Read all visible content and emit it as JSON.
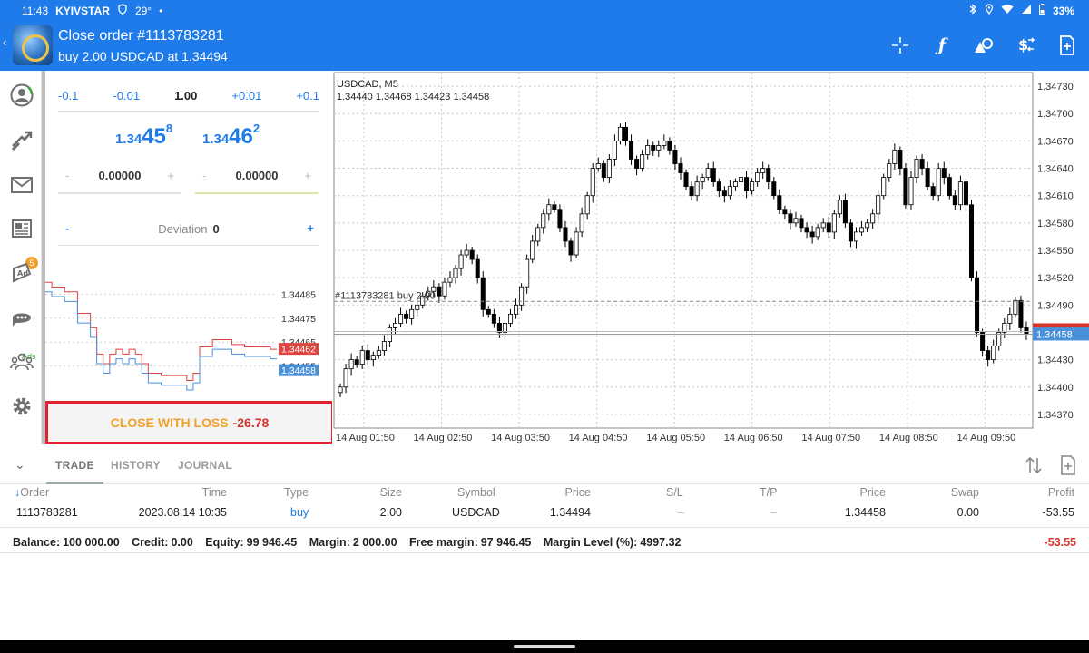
{
  "status": {
    "time": "11:43",
    "carrier": "KYIVSTAR",
    "temp": "29°",
    "dot": "•",
    "battery": "33%"
  },
  "header": {
    "title": "Close order #1113783281",
    "subtitle": "buy 2.00 USDCAD at 1.34494",
    "icons": [
      "crosshair-icon",
      "function-icon",
      "objects-icon",
      "symbol-icon",
      "new-order-icon"
    ]
  },
  "rail": {
    "mail_badge": "5",
    "ads_label": "Ads",
    "icons": [
      "account-icon",
      "trade-icon",
      "mail-icon",
      "news-icon",
      "ads-icon",
      "chat-icon",
      "community-icon",
      "settings-icon"
    ]
  },
  "order": {
    "steps": [
      "-0.1",
      "-0.01",
      "1.00",
      "+0.01",
      "+0.1"
    ],
    "bid": {
      "prefix": "1.34",
      "big": "45",
      "sup": "8"
    },
    "ask": {
      "prefix": "1.34",
      "big": "46",
      "sup": "2"
    },
    "sl": {
      "minus": "-",
      "value": "0.00000",
      "plus": "+"
    },
    "tp": {
      "minus": "-",
      "value": "0.00000",
      "plus": "+"
    },
    "deviation": {
      "minus": "-",
      "label": "Deviation",
      "value": "0",
      "plus": "+"
    },
    "close_button": {
      "label": "CLOSE WITH LOSS",
      "value": "-26.78"
    }
  },
  "mini_chart": {
    "y_ticks": [
      "1.34485",
      "1.34475",
      "1.34465",
      "1.34455"
    ],
    "ask_tag": "1.34462",
    "bid_tag": "1.34458",
    "ask_line": [
      1.3449,
      1.34488,
      1.34488,
      1.34486,
      1.34486,
      1.34477,
      1.34477,
      1.34471,
      1.3446,
      1.34456,
      1.3446,
      1.34462,
      1.3446,
      1.34462,
      1.3446,
      1.34456,
      1.34452,
      1.34452,
      1.34451,
      1.34451,
      1.34451,
      1.34451,
      1.34449,
      1.34452,
      1.34463,
      1.34463,
      1.34466,
      1.34466,
      1.34466,
      1.34464,
      1.34464,
      1.34463,
      1.34463,
      1.34463,
      1.34463,
      1.34462,
      1.34462
    ],
    "colors": {
      "ask": "#e0423f",
      "bid": "#4a90d9"
    }
  },
  "chart": {
    "symbol_line": "USDCAD, M5",
    "ohlc_line": "1.34440 1.34468 1.34423 1.34458",
    "order_label": "#1113783281 buy 2.00",
    "price_tag": "1.34458",
    "y_ticks": [
      "1.34730",
      "1.34700",
      "1.34670",
      "1.34640",
      "1.34610",
      "1.34580",
      "1.34550",
      "1.34520",
      "1.34490",
      "1.34430",
      "1.34400",
      "1.34370"
    ],
    "x_ticks": [
      "14 Aug 01:50",
      "14 Aug 02:50",
      "14 Aug 03:50",
      "14 Aug 04:50",
      "14 Aug 05:50",
      "14 Aug 06:50",
      "14 Aug 07:50",
      "14 Aug 08:50",
      "14 Aug 09:50"
    ]
  },
  "chart_data": {
    "type": "candlestick",
    "title": "USDCAD, M5",
    "ylim": [
      1.34355,
      1.34745
    ],
    "open_price": 1.34494,
    "current_bid": 1.34458,
    "closes": [
      1.344,
      1.3442,
      1.3443,
      1.34425,
      1.3444,
      1.3443,
      1.34435,
      1.3444,
      1.3445,
      1.34465,
      1.3447,
      1.3448,
      1.34475,
      1.34485,
      1.3449,
      1.345,
      1.34505,
      1.3451,
      1.345,
      1.34515,
      1.3452,
      1.3453,
      1.34545,
      1.3455,
      1.3454,
      1.3452,
      1.34485,
      1.3448,
      1.3447,
      1.3446,
      1.3447,
      1.3448,
      1.3449,
      1.3451,
      1.3454,
      1.3456,
      1.34575,
      1.3459,
      1.346,
      1.34595,
      1.34575,
      1.3456,
      1.34545,
      1.3457,
      1.3459,
      1.3461,
      1.3464,
      1.34645,
      1.3463,
      1.3465,
      1.3467,
      1.34685,
      1.3467,
      1.3465,
      1.3464,
      1.34655,
      1.34665,
      1.3466,
      1.34665,
      1.3467,
      1.3466,
      1.34645,
      1.34635,
      1.3462,
      1.3461,
      1.34625,
      1.3463,
      1.3464,
      1.34625,
      1.34615,
      1.3461,
      1.3462,
      1.34625,
      1.3463,
      1.34615,
      1.34625,
      1.34635,
      1.3464,
      1.34625,
      1.3461,
      1.34595,
      1.3459,
      1.3458,
      1.34585,
      1.34575,
      1.3457,
      1.34565,
      1.34575,
      1.3458,
      1.3457,
      1.3459,
      1.34605,
      1.3458,
      1.3456,
      1.3457,
      1.34575,
      1.3458,
      1.3459,
      1.3461,
      1.3463,
      1.34645,
      1.3466,
      1.3464,
      1.346,
      1.3463,
      1.3465,
      1.3464,
      1.3462,
      1.3461,
      1.3464,
      1.3463,
      1.3461,
      1.346,
      1.34625,
      1.346,
      1.3452,
      1.3446,
      1.3444,
      1.3443,
      1.34445,
      1.3446,
      1.3447,
      1.3448,
      1.34495,
      1.34465,
      1.34458
    ]
  },
  "tabs": {
    "items": [
      "TRADE",
      "HISTORY",
      "JOURNAL"
    ],
    "tool_icons": [
      "sort-icon",
      "new-order-icon"
    ]
  },
  "table": {
    "columns": [
      "Order",
      "Time",
      "Type",
      "Size",
      "Symbol",
      "Price",
      "S/L",
      "T/P",
      "Price",
      "Swap",
      "Profit"
    ],
    "sort_arrow": "↓",
    "rows": [
      {
        "order": "1113783281",
        "time": "2023.08.14 10:35",
        "type": "buy",
        "size": "2.00",
        "symbol": "USDCAD",
        "price": "1.34494",
        "sl": "–",
        "tp": "–",
        "cur_price": "1.34458",
        "swap": "0.00",
        "profit": "-53.55"
      }
    ]
  },
  "summary": {
    "balance_label": "Balance:",
    "balance": "100 000.00",
    "credit_label": "Credit:",
    "credit": "0.00",
    "equity_label": "Equity:",
    "equity": "99 946.45",
    "margin_label": "Margin:",
    "margin": "2 000.00",
    "free_label": "Free margin:",
    "free": "97 946.45",
    "level_label": "Margin Level (%):",
    "level": "4997.32",
    "total": "-53.55"
  },
  "colors": {
    "accent": "#1e7be9",
    "loss": "#d6342c",
    "warn": "#f2a02c",
    "bear": "#000000",
    "bull": "#ffffff"
  }
}
